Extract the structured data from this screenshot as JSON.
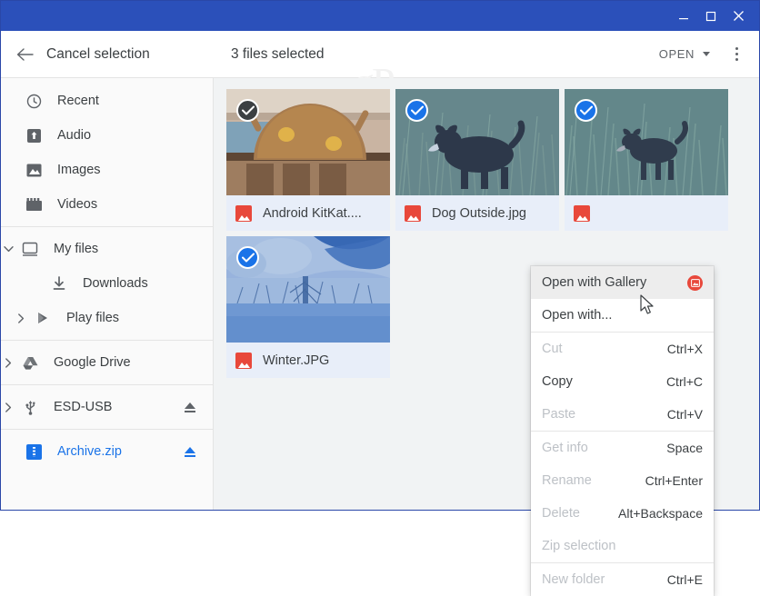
{
  "window": {
    "titlebar_color": "#2b50ba",
    "controls": [
      {
        "name": "minimize",
        "glyph": "minimize-icon"
      },
      {
        "name": "maximize",
        "glyph": "maximize-icon"
      },
      {
        "name": "close",
        "glyph": "close-icon"
      }
    ]
  },
  "toolbar": {
    "back_label": "Cancel selection",
    "selection_count": "3 files selected",
    "open_label": "OPEN",
    "watermark": "gP",
    "back_icon": "arrow-left-icon",
    "overflow_icon": "more-vertical-icon"
  },
  "sidebar": {
    "items": [
      {
        "label": "Recent",
        "icon": "clock-icon",
        "indent": false,
        "twisty": "",
        "eject": false,
        "active": false
      },
      {
        "label": "Audio",
        "icon": "audio-icon",
        "indent": false,
        "twisty": "",
        "eject": false,
        "active": false
      },
      {
        "label": "Images",
        "icon": "image-icon",
        "indent": false,
        "twisty": "",
        "eject": false,
        "active": false
      },
      {
        "label": "Videos",
        "icon": "video-icon",
        "indent": false,
        "twisty": "",
        "eject": false,
        "active": false
      },
      {
        "label": "My files",
        "icon": "computer-icon",
        "indent": false,
        "twisty": "expanded",
        "eject": false,
        "active": false
      },
      {
        "label": "Downloads",
        "icon": "download-icon",
        "indent": true,
        "twisty": "",
        "eject": false,
        "active": false
      },
      {
        "label": "Play files",
        "icon": "play-store-icon",
        "indent": true,
        "twisty": "collapsed",
        "eject": false,
        "active": false
      },
      {
        "label": "Google Drive",
        "icon": "google-drive-icon",
        "indent": false,
        "twisty": "collapsed",
        "eject": false,
        "active": false
      },
      {
        "label": "ESD-USB",
        "icon": "usb-icon",
        "indent": false,
        "twisty": "collapsed",
        "eject": true,
        "active": false
      },
      {
        "label": "Archive.zip",
        "icon": "zip-icon",
        "indent": false,
        "twisty": "",
        "eject": true,
        "active": true
      }
    ],
    "separators_after": [
      3,
      6,
      7,
      8
    ],
    "active_color": "#1a73e8"
  },
  "files": [
    {
      "name": "Android KitKat....",
      "icon": "image-file-icon",
      "selected": true,
      "check_state": "hover",
      "thumb": "android-kitkat-statue"
    },
    {
      "name": "Dog Outside.jpg",
      "icon": "image-file-icon",
      "selected": true,
      "check_state": "selected",
      "thumb": "dog-in-grass"
    },
    {
      "name": "",
      "icon": "image-file-icon",
      "selected": true,
      "check_state": "selected",
      "thumb": "dog-in-field"
    },
    {
      "name": "Winter.JPG",
      "icon": "image-file-icon",
      "selected": true,
      "check_state": "selected",
      "thumb": "winter-snow-scene"
    }
  ],
  "context_menu": {
    "items": [
      {
        "label": "Open with Gallery",
        "accel": "",
        "disabled": false,
        "highlighted": true,
        "app_icon": "gallery-icon"
      },
      {
        "label": "Open with...",
        "accel": "",
        "disabled": false,
        "highlighted": false,
        "app_icon": ""
      },
      {
        "separator": true
      },
      {
        "label": "Cut",
        "accel": "Ctrl+X",
        "disabled": true,
        "highlighted": false,
        "app_icon": ""
      },
      {
        "label": "Copy",
        "accel": "Ctrl+C",
        "disabled": false,
        "highlighted": false,
        "app_icon": ""
      },
      {
        "label": "Paste",
        "accel": "Ctrl+V",
        "disabled": true,
        "highlighted": false,
        "app_icon": ""
      },
      {
        "separator": true
      },
      {
        "label": "Get info",
        "accel": "Space",
        "disabled": true,
        "highlighted": false,
        "app_icon": ""
      },
      {
        "label": "Rename",
        "accel": "Ctrl+Enter",
        "disabled": true,
        "highlighted": false,
        "app_icon": ""
      },
      {
        "label": "Delete",
        "accel": "Alt+Backspace",
        "disabled": true,
        "highlighted": false,
        "app_icon": ""
      },
      {
        "label": "Zip selection",
        "accel": "",
        "disabled": true,
        "highlighted": false,
        "app_icon": ""
      },
      {
        "separator": true
      },
      {
        "label": "New folder",
        "accel": "Ctrl+E",
        "disabled": true,
        "highlighted": false,
        "app_icon": ""
      }
    ]
  },
  "colors": {
    "titlebar": "#2b50ba",
    "accent": "#1a73e8",
    "content_bg": "#f1f3f4",
    "sidebar_bg": "#fafafa",
    "file_icon": "#e8483b"
  }
}
